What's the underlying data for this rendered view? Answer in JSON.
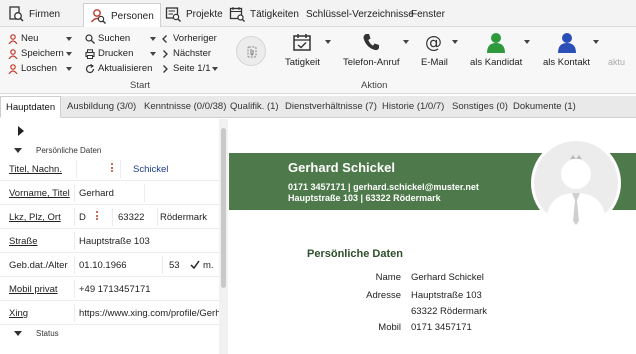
{
  "menu": {
    "items": [
      "Firmen",
      "Personen",
      "Projekte",
      "Tätigkeiten",
      "Schlüssel-Verzeichnisse",
      "Fenster"
    ],
    "active": "Personen"
  },
  "ribbon": {
    "col1": [
      "Neu",
      "Speichern",
      "Loschen"
    ],
    "col2": [
      "Suchen",
      "Drucken",
      "Aktualisieren"
    ],
    "col3": [
      "Vorheriger",
      "Nächster",
      "Seite 1/1"
    ],
    "start_label": "Start",
    "actions": [
      "Tatigkeit",
      "Telefon-Anruf",
      "E-Mail",
      "als Kandidat",
      "als Kontakt",
      "aktu"
    ],
    "aktion_label": "Aktion"
  },
  "tabs": [
    "Hauptdaten",
    "Ausbildung (3/0)",
    "Kenntnisse (0/0/38)",
    "Qualifik. (1)",
    "Dienstverhältnisse (7)",
    "Historie (1/0/7)",
    "Sonstiges (0)",
    "Dokumente (1)"
  ],
  "left": {
    "section_persoenlich": "Persönliche Daten",
    "section_status": "Status",
    "fields": {
      "titel_label": "Titel, Nachn.",
      "titel_value": "Schickel",
      "vorname_label": "Vorname, Titel",
      "vorname_value": "Gerhard",
      "lkz_label": "Lkz, Plz, Ort",
      "lkz_value": "D",
      "plz_value": "63322",
      "ort_value": "Rödermark",
      "strasse_label": "Straße",
      "strasse_value": "Hauptstraße 103",
      "geb_label": "Geb.dat./Alter",
      "geb_value": "01.10.1966",
      "alter_value": "53",
      "geschlecht_value": "m.",
      "mobil_label": "Mobil privat",
      "mobil_value": "+49 1713457171",
      "xing_label": "Xing",
      "xing_value": "https://www.xing.com/profile/Gerha"
    }
  },
  "right": {
    "name": "Gerhard Schickel",
    "contact_line": "0171 3457171 | gerhard.schickel@muster.net",
    "address_line": "Hauptstraße 103 | 63322 Rödermark",
    "pd_title": "Persönliche Daten",
    "rows": [
      {
        "label": "Name",
        "value": "Gerhard Schickel"
      },
      {
        "label": "Adresse",
        "value": "Hauptstraße 103"
      },
      {
        "label": "",
        "value": "63322 Rödermark"
      },
      {
        "label": "Mobil",
        "value": "0171 3457171"
      }
    ]
  },
  "colors": {
    "banner": "#4e7a4b",
    "accent_red": "#c0392b",
    "kandidat_green": "#2e9a3c",
    "kontakt_blue": "#2b4fb8"
  },
  "icons": [
    "companies-icon",
    "persons-icon",
    "projects-icon",
    "activities-icon",
    "new-icon",
    "save-icon",
    "delete-icon",
    "search-icon",
    "print-icon",
    "refresh-icon",
    "prev-icon",
    "next-icon",
    "page-icon",
    "attach-icon",
    "calendar-icon",
    "phone-icon",
    "email-icon",
    "candidate-icon",
    "contact-icon"
  ]
}
